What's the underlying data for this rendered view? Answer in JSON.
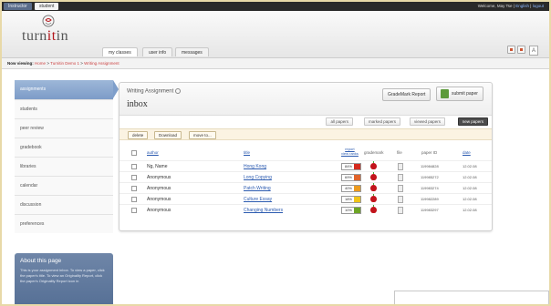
{
  "topbar": {
    "roles": [
      "Instructor",
      "student"
    ],
    "welcome": "Welcome, May Tse",
    "separator1": "|",
    "language": "English",
    "separator2": "|",
    "logout": "logout"
  },
  "logo": {
    "text_prefix": "turn",
    "text_accent": "it",
    "text_suffix": "in"
  },
  "nav": {
    "tabs": [
      "my classes",
      "user info",
      "messages"
    ],
    "active": "my classes"
  },
  "breadcrumb": {
    "label": "Now viewing:",
    "items": [
      "Home",
      "Turnitin Demo 1",
      "Writing Assignment"
    ],
    "separator": ">"
  },
  "sidebar": {
    "items": [
      "assignments",
      "students",
      "peer review",
      "gradebook",
      "libraries",
      "calendar",
      "discussion",
      "preferences"
    ],
    "active": "assignments"
  },
  "about": {
    "title": "About this page",
    "text": "This is your assignment inbox. To view a paper, click the paper's title. To view an Originality Report, click the paper's Originality Report icon in"
  },
  "panel": {
    "assignment_title": "Writing Assignment",
    "inbox_title": "inbox",
    "grademark_report": "GradeMark Report",
    "submit_paper": "submit paper",
    "filters": [
      "all papers",
      "marked papers",
      "viewed papers",
      "new papers"
    ],
    "active_filter": "new papers",
    "actions": [
      "delete",
      "Download",
      "move to..."
    ],
    "columns": {
      "author": "author",
      "title": "title",
      "report_top": "report",
      "report_bottom": "view ranks",
      "grademark": "grademark",
      "file": "file",
      "paper_id": "paper ID",
      "date": "date"
    },
    "rows": [
      {
        "author": "Ng, Name",
        "title": "Hong Kong",
        "score": "84%",
        "score_color": "#d42a1e",
        "paper_id": "119984828",
        "date": "12.02.08"
      },
      {
        "author": "Anonymous",
        "title": "Long Copying",
        "score": "69%",
        "score_color": "#e0632a",
        "paper_id": "119985272",
        "date": "12.02.08"
      },
      {
        "author": "Anonymous",
        "title": "Patch Writing",
        "score": "40%",
        "score_color": "#eb9a1f",
        "paper_id": "119983274",
        "date": "12.02.08"
      },
      {
        "author": "Anonymous",
        "title": "Culture Essay",
        "score": "18%",
        "score_color": "#f0c419",
        "paper_id": "119982289",
        "date": "12.02.08"
      },
      {
        "author": "Anonymous",
        "title": "Changing Numbers",
        "score": "10%",
        "score_color": "#6ea526",
        "paper_id": "119983297",
        "date": "12.02.08"
      }
    ]
  },
  "colors": {
    "brand_red": "#b3161b",
    "link_blue": "#2c5bb0",
    "sidebar_active": "#7d9cc8"
  }
}
